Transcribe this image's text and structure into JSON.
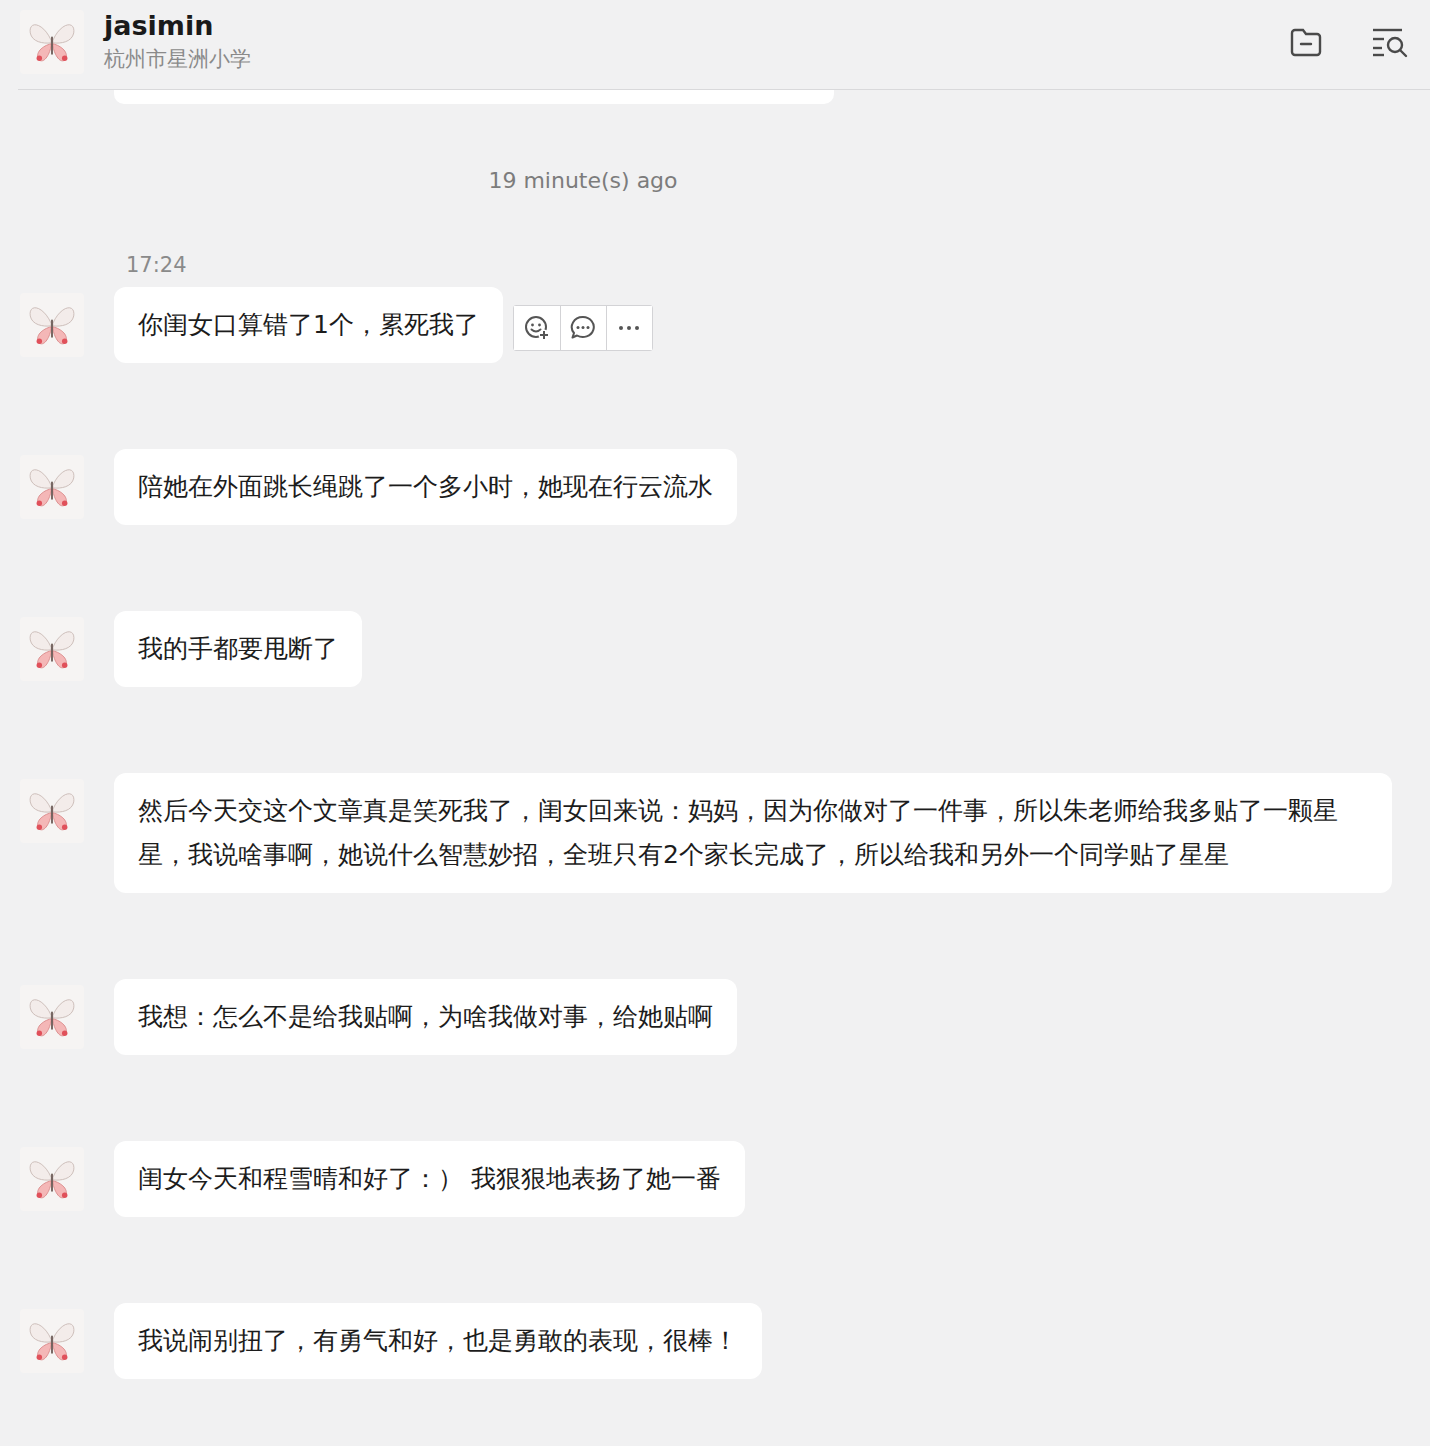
{
  "chat": {
    "name": "jasimin",
    "subtitle": "杭州市星洲小学"
  },
  "divider": "19 minute(s) ago",
  "timestamp": "17:24",
  "messages": [
    {
      "text": "你闺女口算错了1个，累死我了",
      "hovered": true
    },
    {
      "text": "陪她在外面跳长绳跳了一个多小时，她现在行云流水",
      "hovered": false
    },
    {
      "text": "我的手都要甩断了",
      "hovered": false
    },
    {
      "text": "然后今天交这个文章真是笑死我了，闺女回来说：妈妈，因为你做对了一件事，所以朱老师给我多贴了一颗星星，我说啥事啊，她说什么智慧妙招，全班只有2个家长完成了，所以给我和另外一个同学贴了星星",
      "hovered": false
    },
    {
      "text": "我想：怎么不是给我贴啊，为啥我做对事，给她贴啊",
      "hovered": false
    },
    {
      "text": "闺女今天和程雪晴和好了：） 我狠狠地表扬了她一番",
      "hovered": false
    },
    {
      "text": "我说闹别扭了，有勇气和好，也是勇敢的表现，很棒！",
      "hovered": false
    }
  ]
}
